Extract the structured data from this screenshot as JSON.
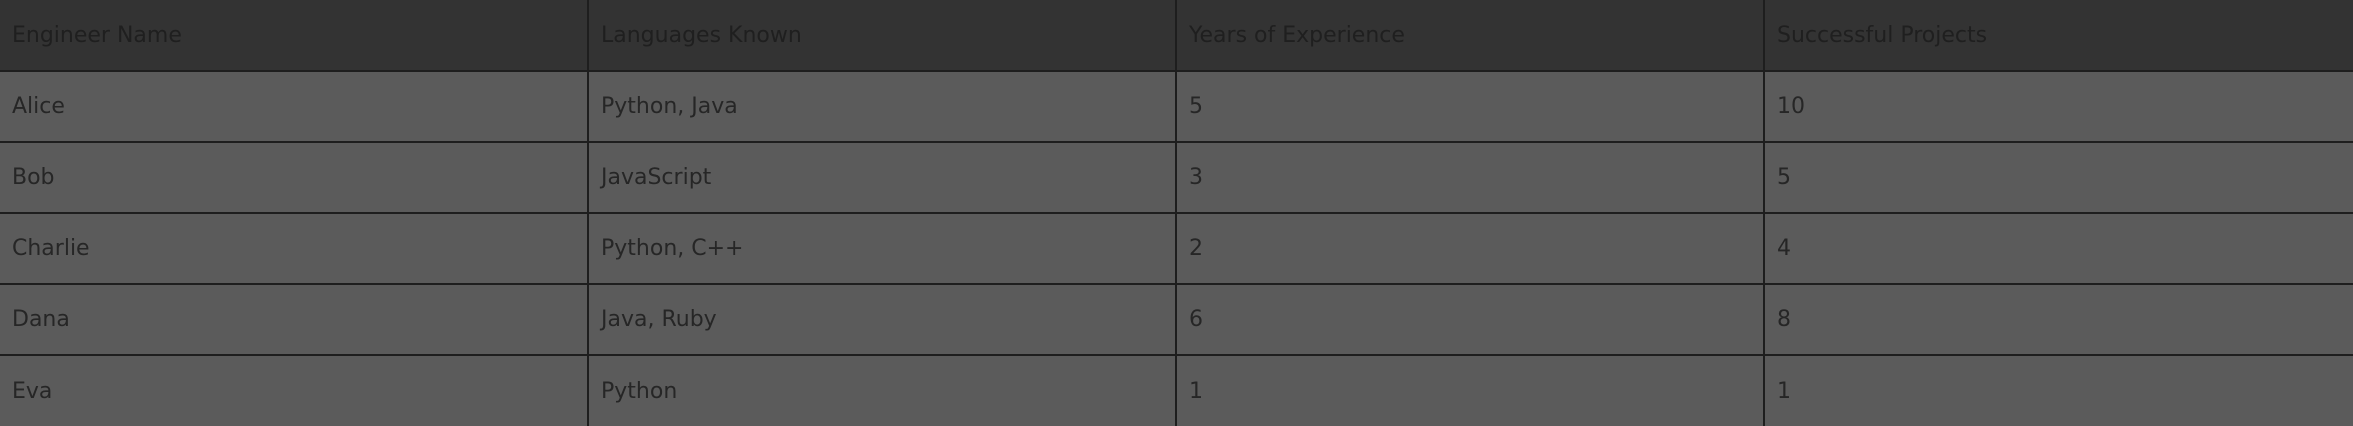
{
  "table": {
    "columns": [
      "Engineer Name",
      "Languages Known",
      "Years of Experience",
      "Successful Projects"
    ],
    "rows": [
      [
        "Alice",
        "Python, Java",
        "5",
        "10"
      ],
      [
        "Bob",
        "JavaScript",
        "3",
        "5"
      ],
      [
        "Charlie",
        "Python, C++",
        "2",
        "4"
      ],
      [
        "Dana",
        "Java, Ruby",
        "6",
        "8"
      ],
      [
        "Eva",
        "Python",
        "1",
        "1"
      ]
    ]
  }
}
